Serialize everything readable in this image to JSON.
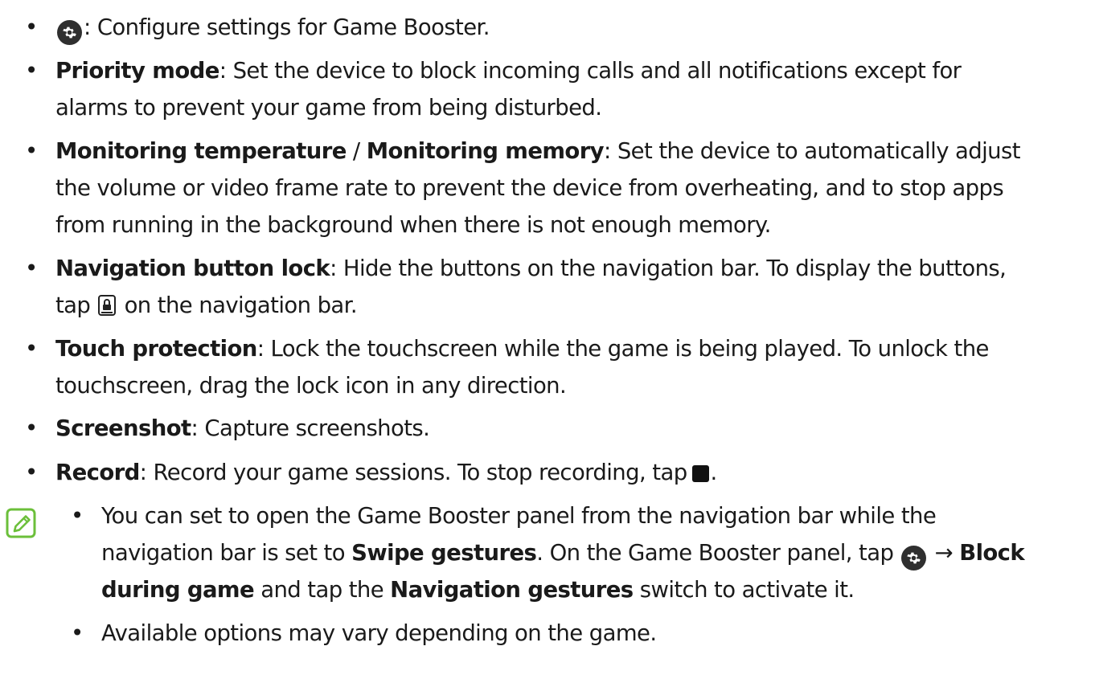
{
  "items": [
    {
      "label": "",
      "sep": ": ",
      "desc": "Configure settings for Game Booster."
    },
    {
      "label": "Priority mode",
      "sep": ": ",
      "desc1": "Set the device to block incoming calls and all notifications except for",
      "desc2": "alarms to prevent your game from being disturbed."
    },
    {
      "label_a": "Monitoring temperature",
      "mid": " / ",
      "label_b": "Monitoring memory",
      "sep": ": ",
      "desc1": "Set the device to automatically adjust",
      "desc2": "the volume or video frame rate to prevent the device from overheating, and to stop apps",
      "desc3": "from running in the background when there is not enough memory."
    },
    {
      "label": "Navigation button lock",
      "sep": ": ",
      "desc1": "Hide the buttons on the navigation bar. To display the buttons,",
      "desc2_a": "tap ",
      "desc2_b": " on the navigation bar."
    },
    {
      "label": "Touch protection",
      "sep": ": ",
      "desc1": "Lock the touchscreen while the game is being played. To unlock the",
      "desc2": "touchscreen, drag the lock icon in any direction."
    },
    {
      "label": "Screenshot",
      "sep": ": ",
      "desc": "Capture screenshots."
    },
    {
      "label": "Record",
      "sep": ": ",
      "desc": "Record your game sessions. To stop recording, tap",
      "end": "."
    }
  ],
  "notes": [
    {
      "line1": "You can set to open the Game Booster panel from the navigation bar while the",
      "line2_a": "navigation bar is set to ",
      "line2_b": "Swipe gestures",
      "line2_c": ". On the Game Booster panel, tap ",
      "line2_arrow": " → ",
      "line2_d": "Block",
      "line3_a": "during game",
      "line3_b": " and tap the ",
      "line3_c": "Navigation gestures",
      "line3_d": " switch to activate it."
    },
    {
      "line1": "Available options may vary depending on the game."
    }
  ],
  "bullet_char": "•",
  "icons": {
    "settings": "gear-icon",
    "lock": "lock-icon",
    "stop": "stop-icon",
    "note": "note-pencil-icon"
  },
  "colors": {
    "text": "#1a1a1a",
    "note_icon": "#6bbf3a",
    "icon_bg": "#2f2f2f"
  }
}
